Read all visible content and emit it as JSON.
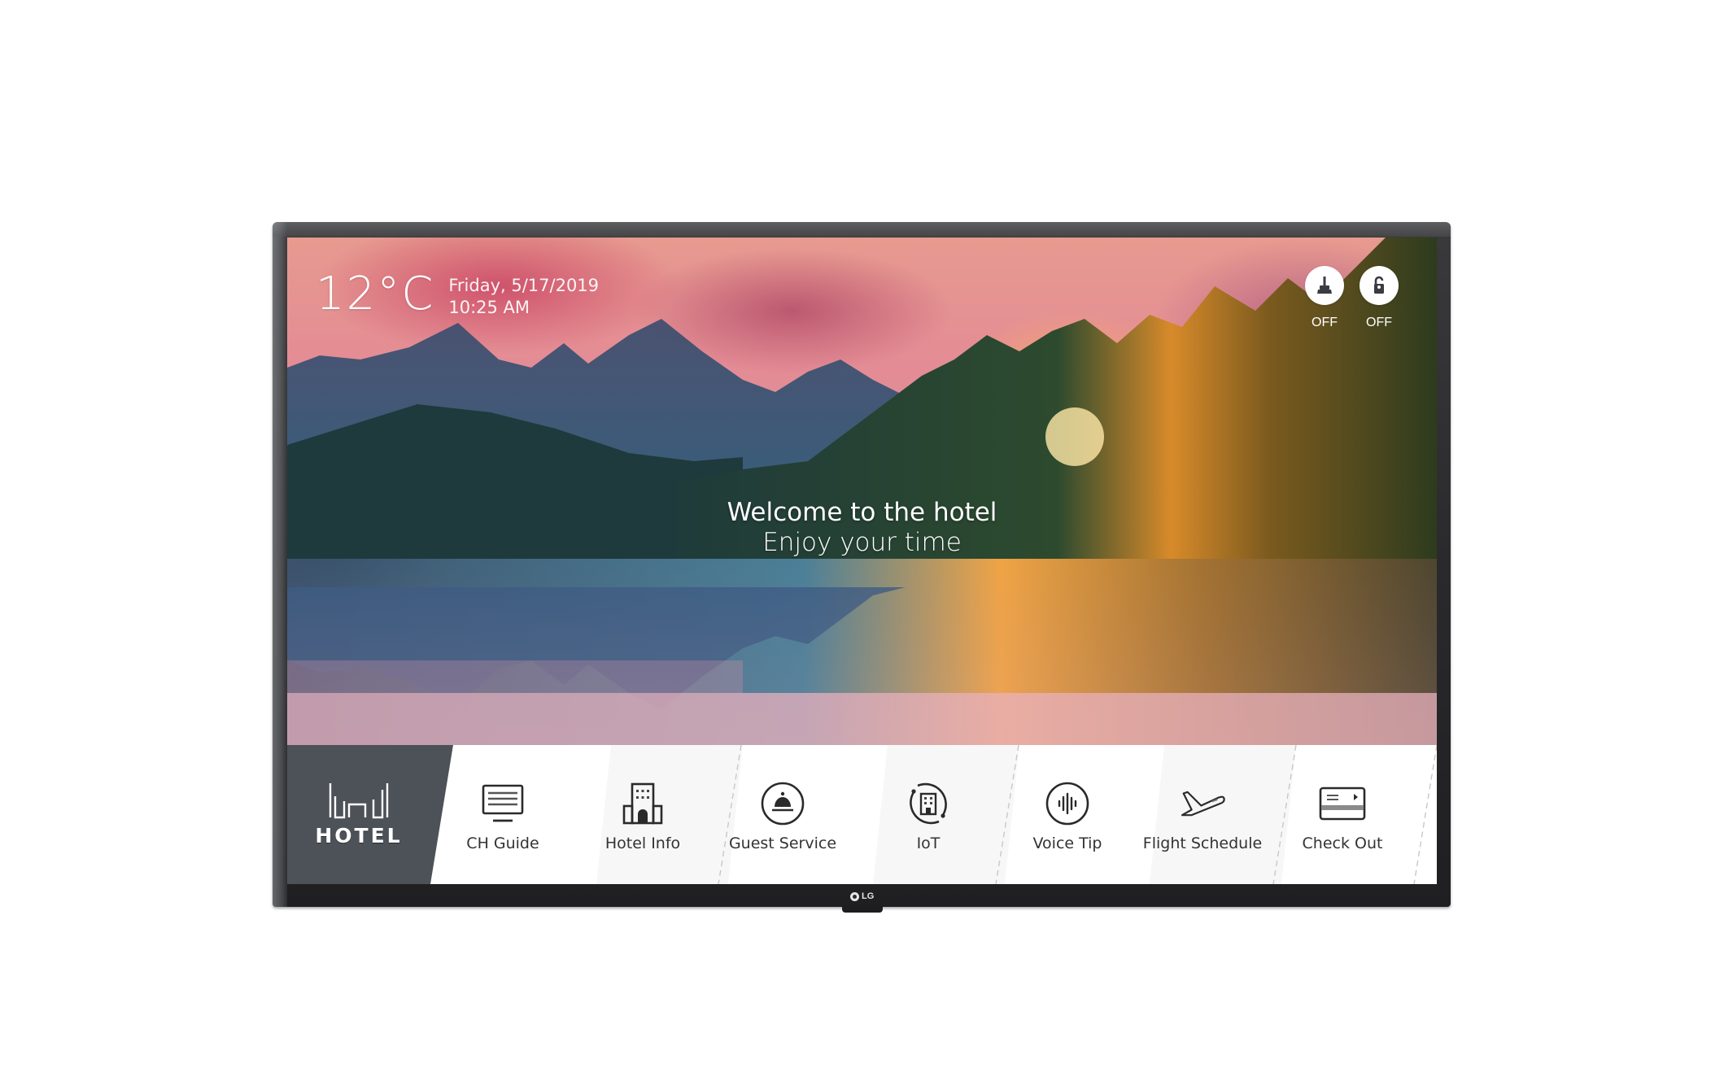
{
  "device": {
    "brand_logo": "LG"
  },
  "screen": {
    "weather": {
      "temperature": "12°C",
      "date": "Friday, 5/17/2019",
      "time": "10:25 AM"
    },
    "status_indicators": [
      {
        "icon": "housekeeping-broom-icon",
        "label": "OFF"
      },
      {
        "icon": "do-not-disturb-door-hanger-icon",
        "label": "OFF"
      }
    ],
    "welcome": {
      "line1": "Welcome to the hotel",
      "line2": "Enjoy your time"
    },
    "menu": {
      "brand": {
        "label": "HOTEL",
        "icon": "hotel-logo-icon"
      },
      "items": [
        {
          "label": "CH Guide",
          "icon": "tv-guide-icon"
        },
        {
          "label": "Hotel Info",
          "icon": "building-icon"
        },
        {
          "label": "Guest Service",
          "icon": "service-bell-icon"
        },
        {
          "label": "IoT",
          "icon": "iot-building-icon"
        },
        {
          "label": "Voice Tip",
          "icon": "voice-wave-icon"
        },
        {
          "label": "Flight Schedule",
          "icon": "airplane-icon"
        },
        {
          "label": "Check Out",
          "icon": "card-icon"
        }
      ]
    }
  },
  "colors": {
    "frame": "#2a2a2c",
    "menu_brand_panel": "#4d5158",
    "menu_background": "#ffffff",
    "menu_text": "#333333",
    "overlay_text": "#ffffff"
  }
}
